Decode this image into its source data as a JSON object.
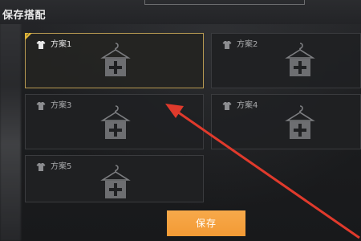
{
  "title": "保存搭配",
  "slots": [
    {
      "label": "方案1",
      "selected": true,
      "shirt_icon": "shirt-icon",
      "add_icon": "hanger-add-icon"
    },
    {
      "label": "方案2",
      "selected": false,
      "shirt_icon": "shirt-icon",
      "add_icon": "hanger-add-icon"
    },
    {
      "label": "方案3",
      "selected": false,
      "shirt_icon": "shirt-icon",
      "add_icon": "hanger-add-icon"
    },
    {
      "label": "方案4",
      "selected": false,
      "shirt_icon": "shirt-icon",
      "add_icon": "hanger-add-icon"
    },
    {
      "label": "方案5",
      "selected": false,
      "shirt_icon": "shirt-icon",
      "add_icon": "hanger-add-icon"
    }
  ],
  "save_button": {
    "label": "保存"
  },
  "colors": {
    "accent_orange": "#f39a35",
    "selected_border": "#b89a52",
    "annotation_red": "#e03a2c"
  }
}
